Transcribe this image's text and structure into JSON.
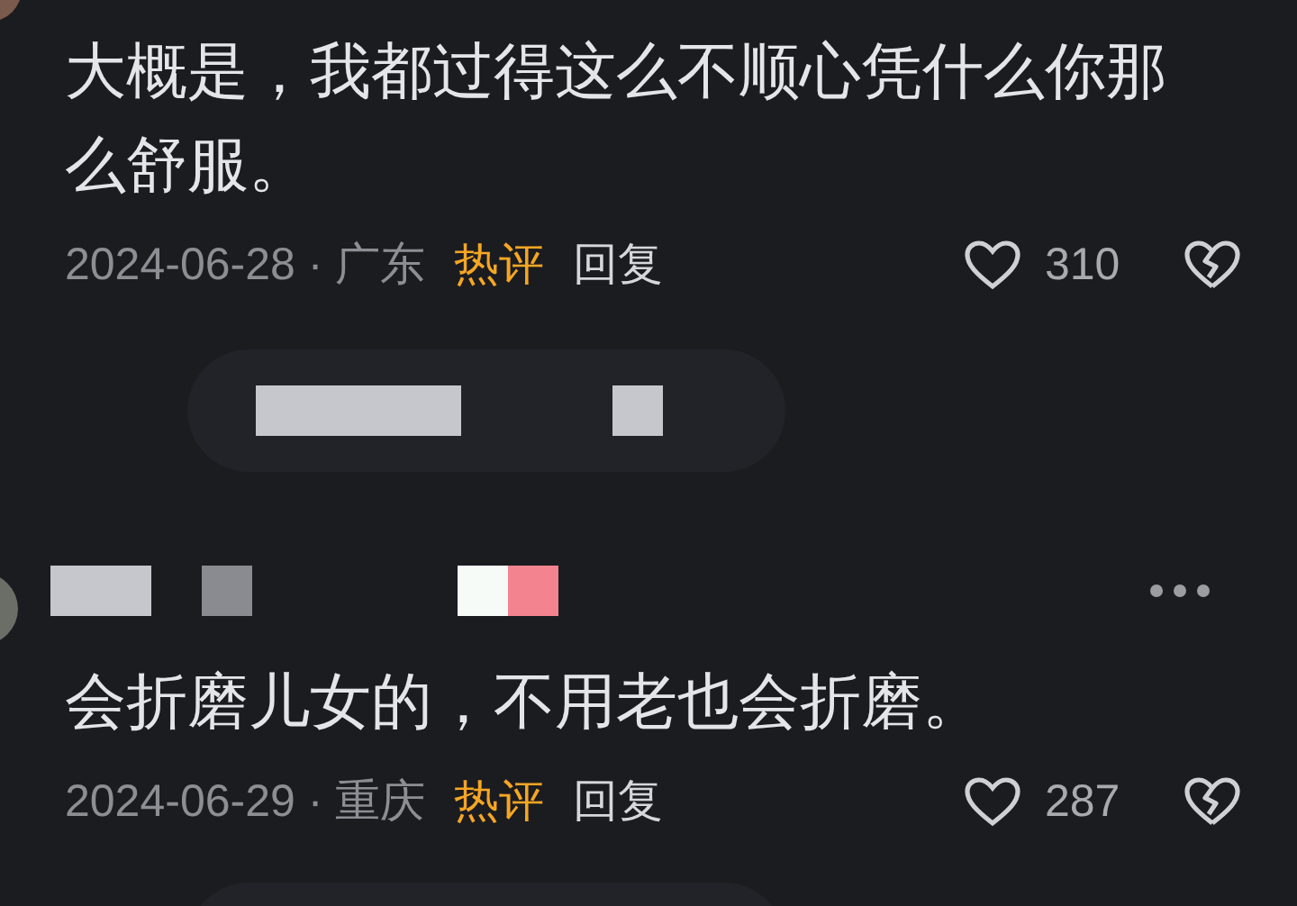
{
  "comments": [
    {
      "kind": "continued",
      "text": "大概是，我都过得这么不顺心凭什么你那么舒服。",
      "date": "2024-06-28 · 广东",
      "badge": "热评",
      "reply": "回复",
      "likes": "310"
    },
    {
      "kind": "full",
      "text": "会折磨儿女的，不用老也会折磨。",
      "date": "2024-06-29 · 重庆",
      "badge": "热评",
      "reply": "回复",
      "likes": "287"
    }
  ]
}
